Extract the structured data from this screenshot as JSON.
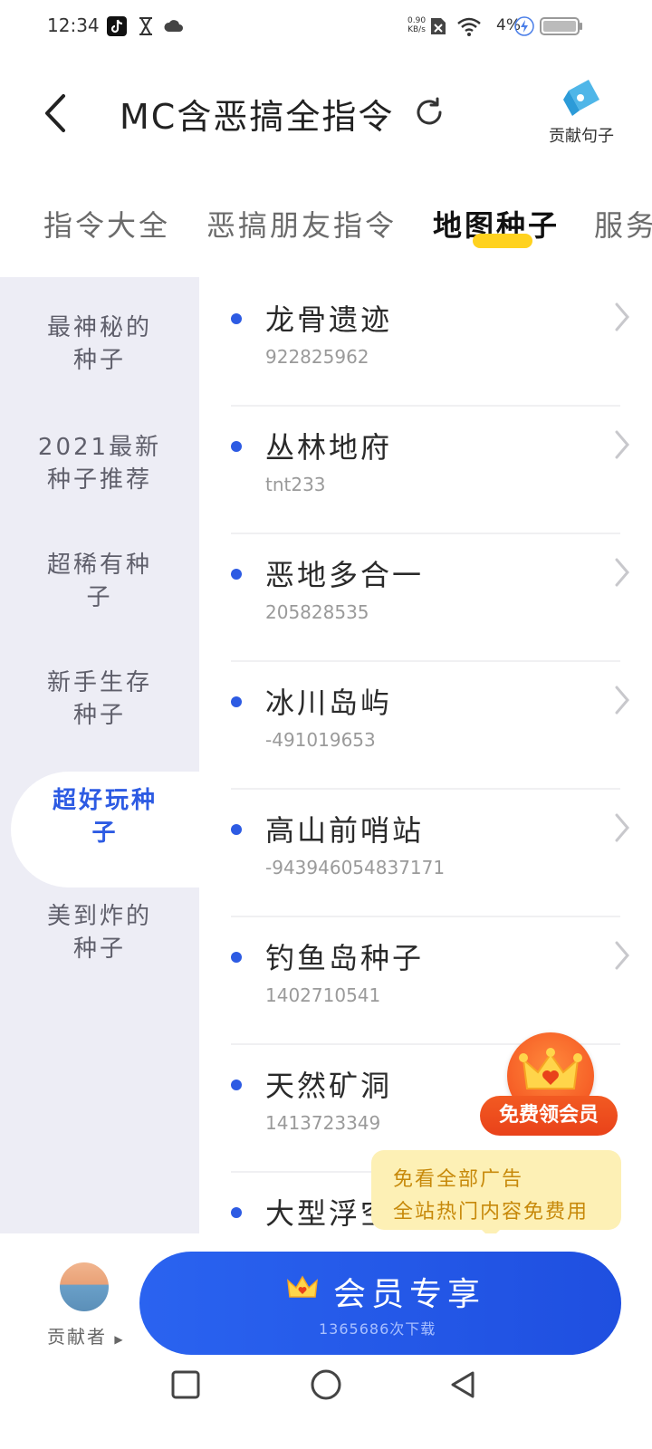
{
  "status_bar": {
    "time": "12:34",
    "net_speed_value": "0.90",
    "net_speed_unit": "KB/s",
    "battery_percent": "4%"
  },
  "header": {
    "title": "MC含恶搞全指令",
    "contribute_label": "贡献句子"
  },
  "tabs": [
    {
      "label": "指令大全",
      "active": false
    },
    {
      "label": "恶搞朋友指令",
      "active": false
    },
    {
      "label": "地图种子",
      "active": true
    },
    {
      "label": "服务",
      "active": false
    }
  ],
  "sidebar": {
    "items": [
      {
        "line1": "最神秘的",
        "line2": "种子"
      },
      {
        "line1": "2021最新",
        "line2": "种子推荐"
      },
      {
        "line1": "超稀有种",
        "line2": "子"
      },
      {
        "line1": "新手生存",
        "line2": "种子"
      },
      {
        "line1": "超好玩种",
        "line2": "子",
        "active": true
      },
      {
        "line1": "美到炸的",
        "line2": "种子"
      }
    ]
  },
  "list": {
    "items": [
      {
        "title": "龙骨遗迹",
        "seed": "922825962"
      },
      {
        "title": "丛林地府",
        "seed": "tnt233"
      },
      {
        "title": "恶地多合一",
        "seed": "205828535"
      },
      {
        "title": "冰川岛屿",
        "seed": "-491019653"
      },
      {
        "title": "高山前哨站",
        "seed": "-943946054837171"
      },
      {
        "title": "钓鱼岛种子",
        "seed": "1402710541"
      },
      {
        "title": "天然矿洞",
        "seed": "1413723349"
      },
      {
        "title": "大型浮空",
        "seed": ""
      }
    ]
  },
  "vip_float": {
    "label": "免费领会员"
  },
  "tooltip": {
    "line1": "免看全部广告",
    "line2": "全站热门内容免费用"
  },
  "bottom": {
    "contributor_label": "贡献者",
    "vip_button_label": "会员专享",
    "download_count": "1365686次下载"
  },
  "colors": {
    "accent_blue": "#2d5be3",
    "tab_highlight": "#ffd21f",
    "sidebar_bg": "#ededf5",
    "vip_orange": "#f24a1c",
    "tooltip_bg": "#fdf0b5"
  }
}
